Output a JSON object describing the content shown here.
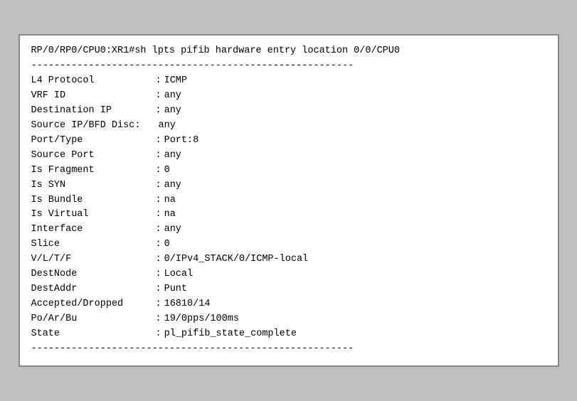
{
  "terminal": {
    "prompt_line": "RP/0/RP0/CPU0:XR1#sh lpts pifib hardware entry location 0/0/CPU0",
    "divider": "--------------------------------------------------------",
    "rows": [
      {
        "key": "L4 Protocol",
        "value": "ICMP"
      },
      {
        "key": "VRF ID",
        "value": "any"
      },
      {
        "key": "Destination IP",
        "value": "any"
      },
      {
        "key": "Source IP/BFD Disc:",
        "value": "any"
      },
      {
        "key": "Port/Type",
        "value": "Port:8"
      },
      {
        "key": "Source Port",
        "value": "any"
      },
      {
        "key": "Is Fragment",
        "value": "0"
      },
      {
        "key": "Is SYN",
        "value": "any"
      },
      {
        "key": "Is Bundle",
        "value": "na"
      },
      {
        "key": "Is Virtual",
        "value": "na"
      },
      {
        "key": "Interface",
        "value": "any"
      },
      {
        "key": "Slice",
        "value": "0"
      },
      {
        "key": "V/L/T/F",
        "value": "0/IPv4_STACK/0/ICMP-local"
      },
      {
        "key": "DestNode",
        "value": "Local"
      },
      {
        "key": "DestAddr",
        "value": "Punt"
      },
      {
        "key": "Accepted/Dropped",
        "value": "16810/14"
      },
      {
        "key": "Po/Ar/Bu",
        "value": "19/0pps/100ms"
      },
      {
        "key": "State",
        "value": "pl_pifib_state_complete"
      }
    ],
    "divider_bottom": "--------------------------------------------------------"
  }
}
